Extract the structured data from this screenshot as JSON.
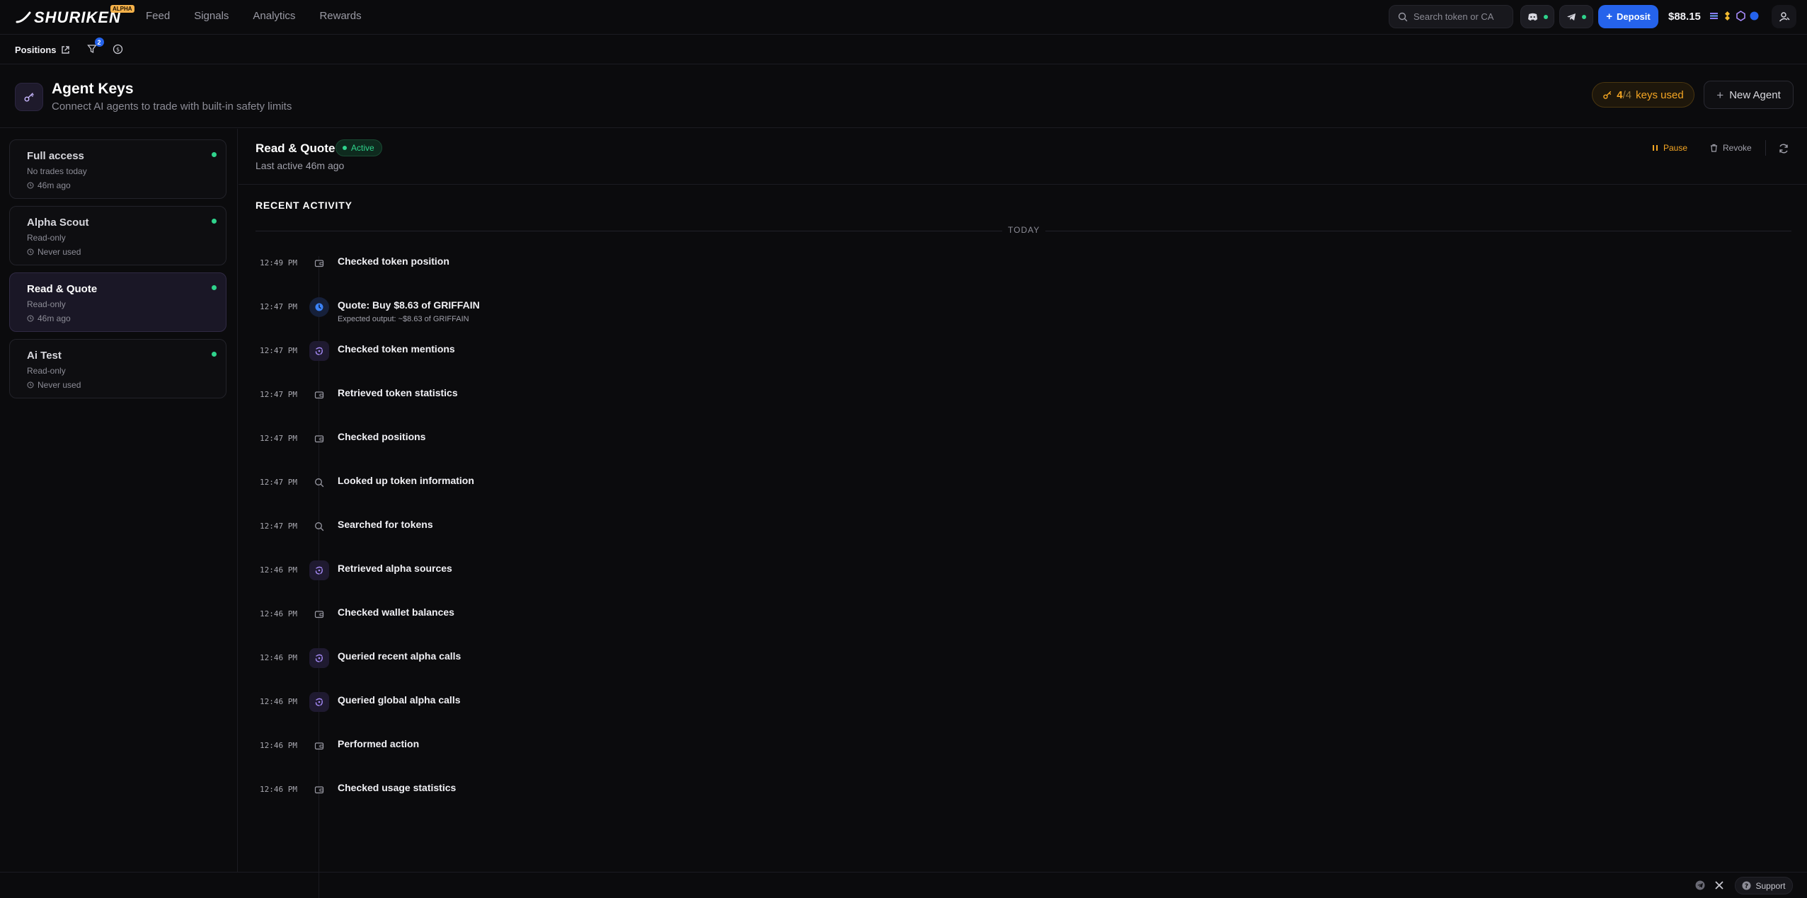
{
  "app": {
    "brand": "SHURIKEN",
    "brand_badge": "ALPHA",
    "nav": [
      "Feed",
      "Signals",
      "Analytics",
      "Rewards"
    ],
    "search_placeholder": "Search token or CA",
    "deposit_label": "Deposit",
    "balance": "$88.15"
  },
  "subbar": {
    "positions_label": "Positions",
    "filter_count": "2"
  },
  "header": {
    "title": "Agent Keys",
    "subtitle": "Connect AI agents to trade with built-in safety limits",
    "keys_used_count": "4",
    "keys_total": "/4",
    "keys_used_suffix": "keys used",
    "new_agent_label": "New Agent"
  },
  "agents": [
    {
      "name": "Full access",
      "scope": "No trades today",
      "last": "46m ago",
      "selected": false
    },
    {
      "name": "Alpha Scout",
      "scope": "Read-only",
      "last": "Never used",
      "selected": false
    },
    {
      "name": "Read & Quote",
      "scope": "Read-only",
      "last": "46m ago",
      "selected": true
    },
    {
      "name": "Ai Test",
      "scope": "Read-only",
      "last": "Never used",
      "selected": false
    }
  ],
  "detail": {
    "title": "Read & Quote",
    "status": "Active",
    "last_active": "Last active 46m ago",
    "pause_label": "Pause",
    "revoke_label": "Revoke",
    "section_title": "RECENT ACTIVITY",
    "day_label": "TODAY"
  },
  "activity": [
    {
      "time": "12:49 PM",
      "title": "Checked token position",
      "sub": "",
      "icon": "wallet-icon"
    },
    {
      "time": "12:47 PM",
      "title": "Quote: Buy $8.63 of GRIFFAIN",
      "sub": "Expected output: ~$8.63 of GRIFFAIN",
      "icon": "quote-clock-icon"
    },
    {
      "time": "12:47 PM",
      "title": "Checked token mentions",
      "sub": "",
      "icon": "spark-icon"
    },
    {
      "time": "12:47 PM",
      "title": "Retrieved token statistics",
      "sub": "",
      "icon": "wallet-icon"
    },
    {
      "time": "12:47 PM",
      "title": "Checked positions",
      "sub": "",
      "icon": "wallet-icon"
    },
    {
      "time": "12:47 PM",
      "title": "Looked up token information",
      "sub": "",
      "icon": "search-icon"
    },
    {
      "time": "12:47 PM",
      "title": "Searched for tokens",
      "sub": "",
      "icon": "search-icon"
    },
    {
      "time": "12:46 PM",
      "title": "Retrieved alpha sources",
      "sub": "",
      "icon": "spark-icon"
    },
    {
      "time": "12:46 PM",
      "title": "Checked wallet balances",
      "sub": "",
      "icon": "wallet-icon"
    },
    {
      "time": "12:46 PM",
      "title": "Queried recent alpha calls",
      "sub": "",
      "icon": "spark-icon"
    },
    {
      "time": "12:46 PM",
      "title": "Queried global alpha calls",
      "sub": "",
      "icon": "spark-icon"
    },
    {
      "time": "12:46 PM",
      "title": "Performed action",
      "sub": "",
      "icon": "wallet-icon"
    },
    {
      "time": "12:46 PM",
      "title": "Checked usage statistics",
      "sub": "",
      "icon": "wallet-icon"
    }
  ],
  "footer": {
    "support_label": "Support"
  },
  "colors": {
    "accent_blue": "#2563eb",
    "active_green": "#2fd38c",
    "warning_orange": "#f5a623",
    "selected_bg": "#1a1726"
  }
}
